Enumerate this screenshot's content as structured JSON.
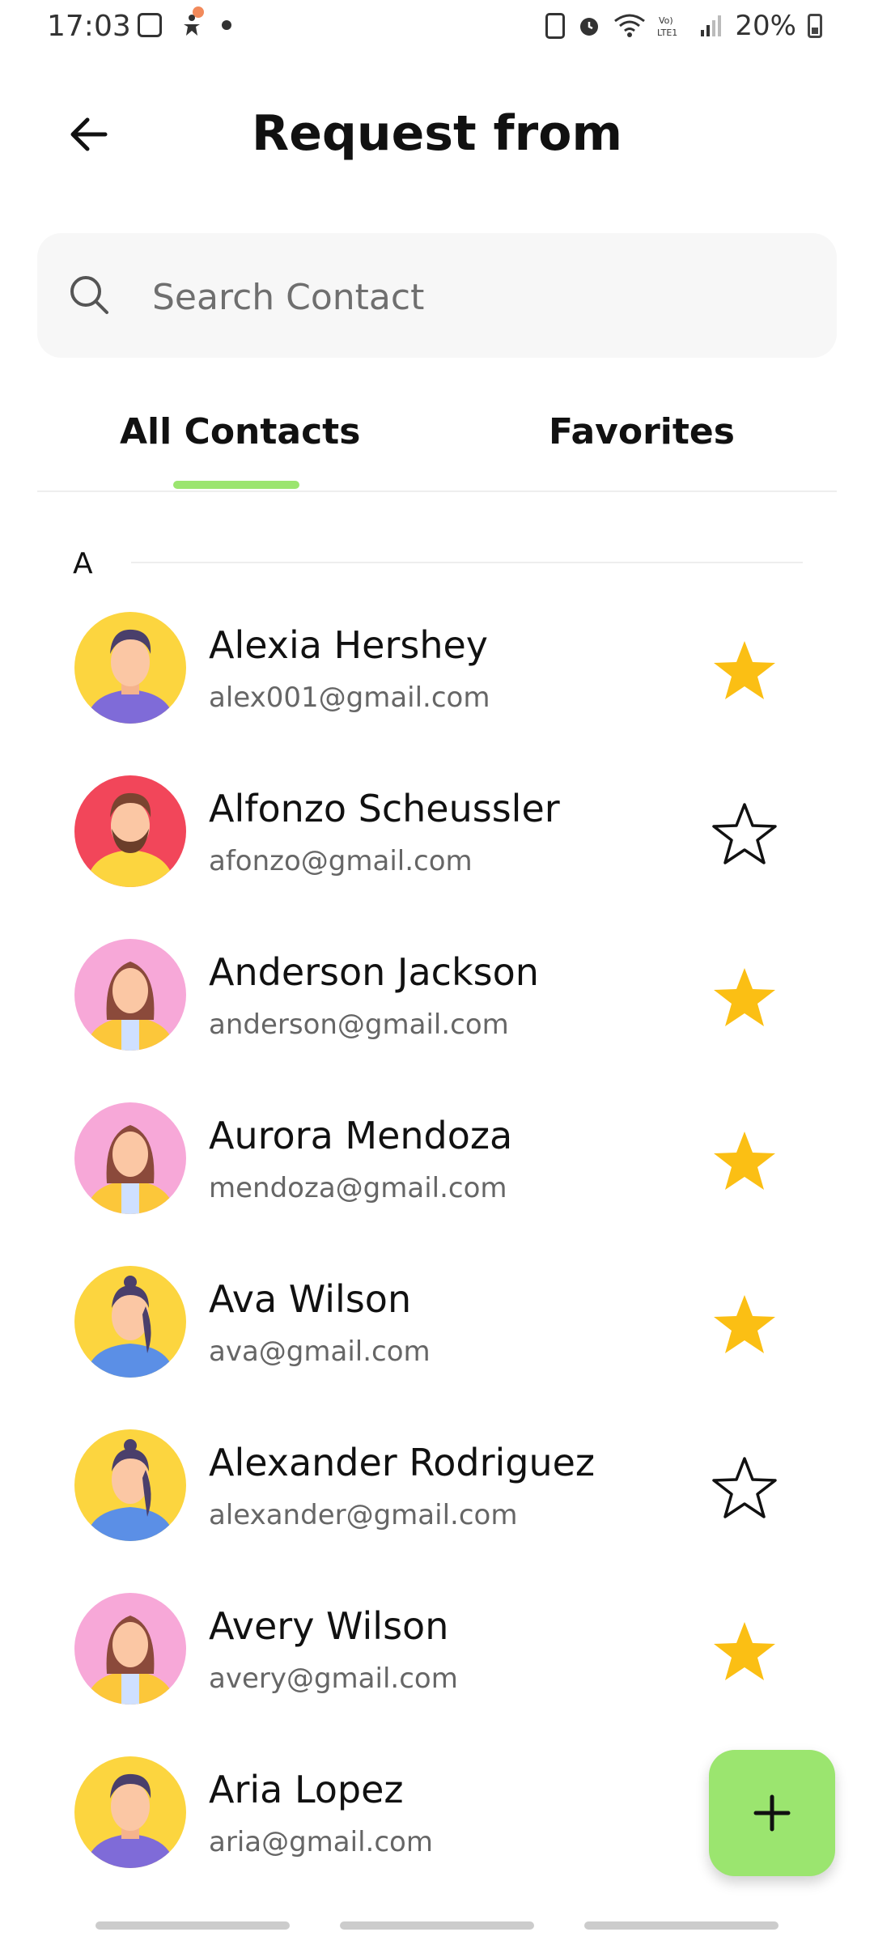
{
  "status_bar": {
    "time": "17:03",
    "battery": "20%"
  },
  "header": {
    "title": "Request from"
  },
  "search": {
    "placeholder": "Search Contact"
  },
  "tabs": [
    {
      "label": "All Contacts",
      "selected": true
    },
    {
      "label": "Favorites",
      "selected": false
    }
  ],
  "section": {
    "letter": "A"
  },
  "contacts": [
    {
      "name": "Alexia Hershey",
      "email": "alex001@gmail.com",
      "favorite": true,
      "avatar": "man-purple-shirt-yellow-bg"
    },
    {
      "name": "Alfonzo Scheussler",
      "email": "afonzo@gmail.com",
      "favorite": false,
      "avatar": "bearded-man-red-bg"
    },
    {
      "name": "Anderson Jackson",
      "email": "anderson@gmail.com",
      "favorite": true,
      "avatar": "woman-yellow-jacket-pink-bg"
    },
    {
      "name": "Aurora Mendoza",
      "email": "mendoza@gmail.com",
      "favorite": true,
      "avatar": "woman-yellow-jacket-pink-bg"
    },
    {
      "name": "Ava Wilson",
      "email": "ava@gmail.com",
      "favorite": true,
      "avatar": "woman-ponytail-blue-yellow-bg"
    },
    {
      "name": "Alexander Rodriguez",
      "email": "alexander@gmail.com",
      "favorite": false,
      "avatar": "woman-ponytail-blue-yellow-bg"
    },
    {
      "name": "Avery Wilson",
      "email": "avery@gmail.com",
      "favorite": true,
      "avatar": "woman-yellow-jacket-pink-bg"
    },
    {
      "name": "Aria Lopez",
      "email": "aria@gmail.com",
      "favorite": false,
      "avatar": "man-purple-shirt-yellow-bg"
    }
  ],
  "colors": {
    "accent": "#9be56f",
    "star": "#fbbf14",
    "search_bg": "#f7f7f7"
  },
  "fab": {
    "icon": "plus-icon"
  }
}
